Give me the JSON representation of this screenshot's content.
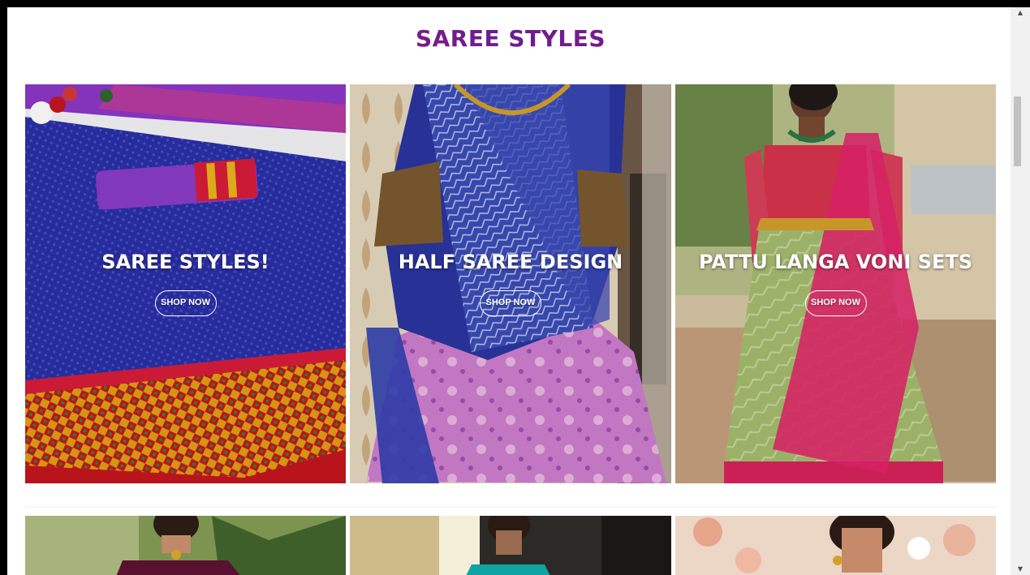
{
  "section": {
    "title": "SAREE STYLES"
  },
  "cards": [
    {
      "heading": "SAREE STYLES!",
      "button": "SHOP NOW",
      "image_icon": "saree-fabric-image",
      "colors": {
        "primary": "#2a2fa6",
        "accent": "#d81c3a",
        "secondary": "#7a2fb8"
      }
    },
    {
      "heading": "HALF SAREE DESIGN",
      "button": "SHOP NOW",
      "image_icon": "half-saree-image",
      "colors": {
        "primary": "#2b3aa8",
        "accent": "#c77fc2",
        "secondary": "#d9c9a8"
      }
    },
    {
      "heading": "PATTU LANGA VONI SETS",
      "button": "SHOP NOW",
      "image_icon": "langa-voni-image",
      "colors": {
        "primary": "#e2246b",
        "accent": "#a3b86a",
        "secondary": "#c9b08a"
      }
    }
  ],
  "row2": [
    {
      "image_icon": "model-green-background-image",
      "colors": {
        "primary": "#6a7f3d",
        "accent": "#5a1030"
      }
    },
    {
      "image_icon": "model-teal-saree-image",
      "colors": {
        "primary": "#2a2a2a",
        "accent": "#0fa3a3"
      }
    },
    {
      "image_icon": "bride-floral-background-image",
      "colors": {
        "primary": "#e7c9b7",
        "accent": "#8a1c22"
      }
    }
  ],
  "scrollbar": {
    "up": "▲",
    "down": "▼"
  }
}
